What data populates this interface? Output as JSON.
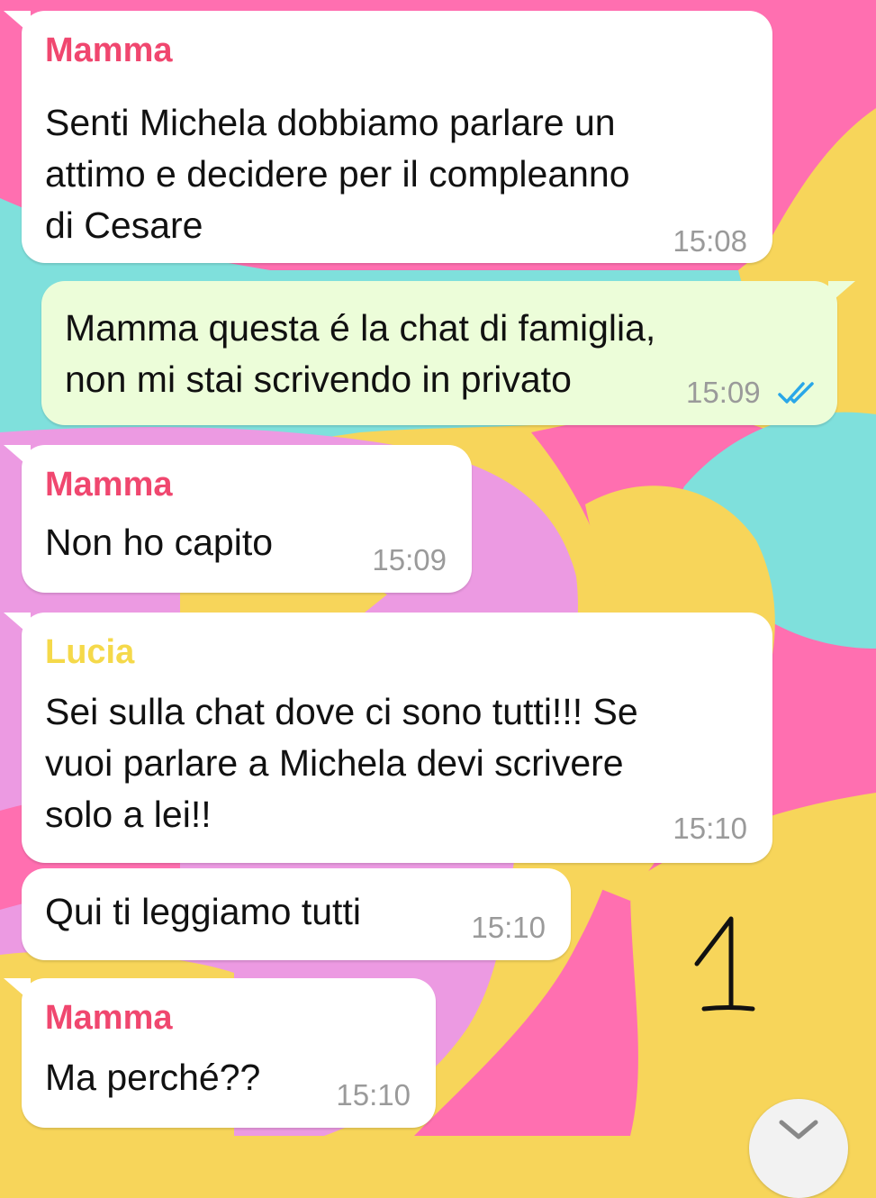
{
  "colors": {
    "mamma_name": "#f0476f",
    "lucia_name": "#f5d94a",
    "incoming_bubble": "#ffffff",
    "outgoing_bubble": "#ecfdd9",
    "timestamp": "#9a9a9a",
    "read_ticks": "#2aa7e8"
  },
  "messages": [
    {
      "sender": "Mamma",
      "lines": [
        "Senti Michela dobbiamo parlare un",
        "attimo e decidere per il compleanno",
        "di Cesare"
      ],
      "time": "15:08"
    },
    {
      "lines": [
        "Mamma questa é la chat di famiglia,",
        "non mi stai scrivendo in privato"
      ],
      "time": "15:09",
      "status_icon": "double-check-read-icon"
    },
    {
      "sender": "Mamma",
      "lines": [
        "Non ho capito"
      ],
      "time": "15:09"
    },
    {
      "sender": "Lucia",
      "lines": [
        "Sei sulla chat dove ci sono tutti!!! Se",
        "vuoi parlare a Michela devi scrivere",
        "solo a lei!!"
      ],
      "time": "15:10"
    },
    {
      "lines": [
        "Qui ti leggiamo tutti"
      ],
      "time": "15:10"
    },
    {
      "sender": "Mamma",
      "lines": [
        "Ma perché??"
      ],
      "time": "15:10"
    }
  ],
  "overlay": {
    "handwritten_number": "1",
    "scroll_button_icon": "chevron-down-icon"
  }
}
